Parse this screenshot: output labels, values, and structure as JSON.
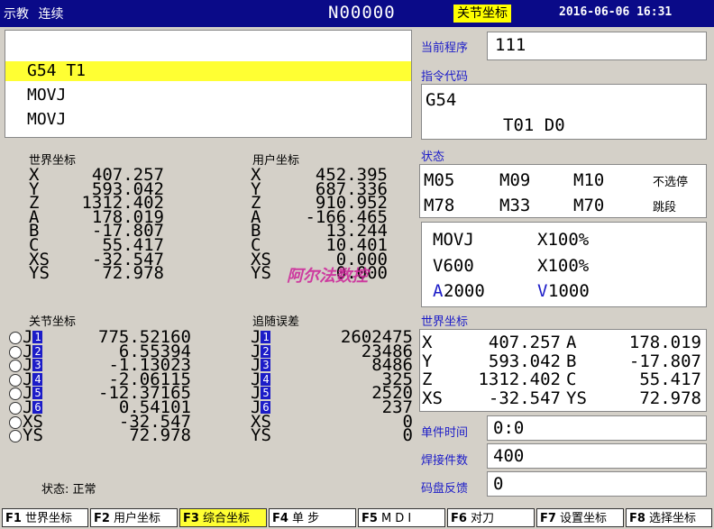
{
  "topbar": {
    "mode_text": "示教  连续",
    "program": "N00000",
    "coord_mode": "关节坐标",
    "datetime": "2016-06-06 16:31"
  },
  "code_lines": [
    "G54 T1",
    "MOVJ",
    "MOVJ"
  ],
  "world": {
    "label": "世界坐标",
    "rows": [
      [
        "X",
        "407.257"
      ],
      [
        "Y",
        "593.042"
      ],
      [
        "Z",
        "1312.402"
      ],
      [
        "A",
        "178.019"
      ],
      [
        "B",
        "-17.807"
      ],
      [
        "C",
        "55.417"
      ],
      [
        "XS",
        "-32.547"
      ],
      [
        "YS",
        "72.978"
      ]
    ]
  },
  "user": {
    "label": "用户坐标",
    "rows": [
      [
        "X",
        "452.395"
      ],
      [
        "Y",
        "687.336"
      ],
      [
        "Z",
        "910.952"
      ],
      [
        "A",
        "-166.465"
      ],
      [
        "B",
        "13.244"
      ],
      [
        "C",
        "10.401"
      ],
      [
        "XS",
        "0.000"
      ],
      [
        "YS",
        "0.000"
      ]
    ]
  },
  "joint": {
    "label": "关节坐标",
    "rows": [
      [
        "J",
        "1",
        "775.52160"
      ],
      [
        "J",
        "2",
        "6.55394"
      ],
      [
        "J",
        "3",
        "-1.13023"
      ],
      [
        "J",
        "4",
        "-2.06115"
      ],
      [
        "J",
        "5",
        "-12.37165"
      ],
      [
        "J",
        "6",
        "0.54101"
      ],
      [
        "XS",
        "",
        "-32.547"
      ],
      [
        "YS",
        "",
        "72.978"
      ]
    ]
  },
  "follow": {
    "label": "追随误差",
    "rows": [
      [
        "J",
        "1",
        "2602475"
      ],
      [
        "J",
        "2",
        "23486"
      ],
      [
        "J",
        "3",
        "8486"
      ],
      [
        "J",
        "4",
        "325"
      ],
      [
        "J",
        "5",
        "2520"
      ],
      [
        "J",
        "6",
        "237"
      ],
      [
        "XS",
        "",
        "0"
      ],
      [
        "YS",
        "",
        "0"
      ]
    ]
  },
  "watermark": "阿尔法数控",
  "status_left": "状态:  正常",
  "right": {
    "cur_prog_label": "当前程序",
    "cur_prog": "111",
    "cmd_label": "指令代码",
    "cmd_line1": "G54",
    "cmd_line2": "T01 D0",
    "state_label": "状态",
    "mcodes": [
      [
        "M05",
        "M09",
        "M10",
        "不选停"
      ],
      [
        "M78",
        "M33",
        "M70",
        "跳段"
      ]
    ],
    "motion": [
      [
        "MOVJ",
        "X100%"
      ],
      [
        "V600",
        "X100%"
      ]
    ],
    "accel_a": "A",
    "accel_a_val": "2000",
    "accel_v": "V",
    "accel_v_val": "1000",
    "world_label": "世界坐标",
    "world_grid": [
      [
        "X",
        "407.257",
        "A",
        "178.019"
      ],
      [
        "Y",
        "593.042",
        "B",
        "-17.807"
      ],
      [
        "Z",
        "1312.402",
        "C",
        "55.417"
      ],
      [
        "XS",
        "-32.547",
        "YS",
        "72.978"
      ]
    ],
    "unit_time_label": "单件时间",
    "unit_time": "0:0",
    "weld_count_label": "焊接件数",
    "weld_count": "400",
    "encoder_label": "码盘反馈",
    "encoder": "0"
  },
  "fkeys": [
    {
      "n": "F1",
      "label": "世界坐标"
    },
    {
      "n": "F2",
      "label": "用户坐标"
    },
    {
      "n": "F3",
      "label": "综合坐标"
    },
    {
      "n": "F4",
      "label": "单 步"
    },
    {
      "n": "F5",
      "label": "M D I"
    },
    {
      "n": "F6",
      "label": "对刀"
    },
    {
      "n": "F7",
      "label": "设置坐标"
    },
    {
      "n": "F8",
      "label": "选择坐标"
    }
  ],
  "colors": {
    "topbar": "#0a0a88",
    "highlight": "#ffff33",
    "label_blue": "#1c1cc8",
    "watermark": "#cc2299"
  }
}
